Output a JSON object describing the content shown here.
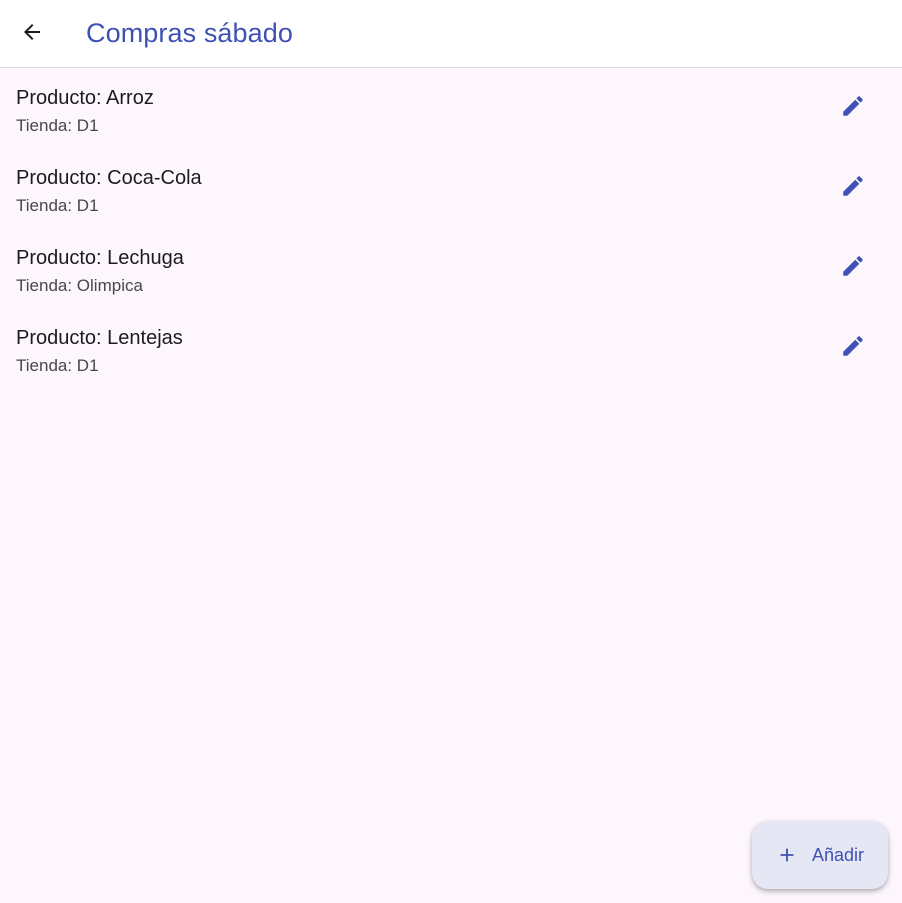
{
  "app_bar": {
    "title": "Compras sábado",
    "back_icon": "arrow-back-icon"
  },
  "colors": {
    "accent": "#3f51b5",
    "background": "#fdf7fd",
    "app_bar": "#ffffff",
    "fab_background": "#e5e7f4"
  },
  "items": [
    {
      "title": "Producto: Arroz",
      "subtitle": "Tienda: D1",
      "action_icon": "edit-pencil-icon"
    },
    {
      "title": "Producto: Coca-Cola",
      "subtitle": "Tienda: D1",
      "action_icon": "edit-pencil-icon"
    },
    {
      "title": "Producto: Lechuga",
      "subtitle": "Tienda: Olimpica",
      "action_icon": "edit-pencil-icon"
    },
    {
      "title": "Producto: Lentejas",
      "subtitle": "Tienda: D1",
      "action_icon": "edit-pencil-icon"
    }
  ],
  "fab": {
    "label": "Añadir",
    "icon": "plus-icon"
  }
}
